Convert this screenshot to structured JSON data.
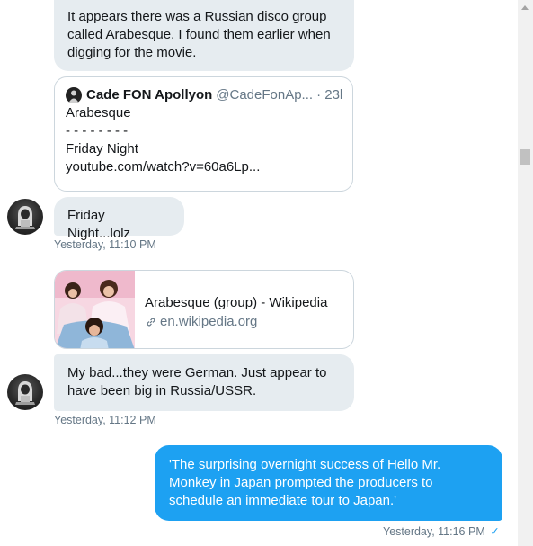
{
  "messages": {
    "m1_text": "It appears there was a Russian disco group called Arabesque. I found them earlier when digging for the movie.",
    "quote": {
      "name": "Cade FON Apollyon",
      "handle": "@CadeFonAp...",
      "time": "· 23h",
      "line1": "Arabesque",
      "line2": "- - - - - - - -",
      "line3": "Friday Night",
      "line4": "youtube.com/watch?v=60a6Lp..."
    },
    "m2_text": "Friday Night...lolz",
    "m2_time": "Yesterday, 11:10 PM",
    "link": {
      "title": "Arabesque (group) - Wikipedia",
      "url": "en.wikipedia.org"
    },
    "m3_text": "My bad...they were German. Just appear to have been big in Russia/USSR.",
    "m3_time": "Yesterday, 11:12 PM",
    "m4_text": "'The surprising overnight success of Hello Mr. Monkey in Japan prompted the producers to schedule an immediate tour to Japan.'",
    "m4_time": "Yesterday, 11:16 PM",
    "m4_status": "✓"
  },
  "colors": {
    "incoming_bubble": "#e6ecf0",
    "outgoing_bubble": "#1da1f2",
    "meta_text": "#657786",
    "check": "#1da1f2"
  },
  "icons": {
    "avatar": "hooded-figure-avatar",
    "link": "link-icon"
  }
}
